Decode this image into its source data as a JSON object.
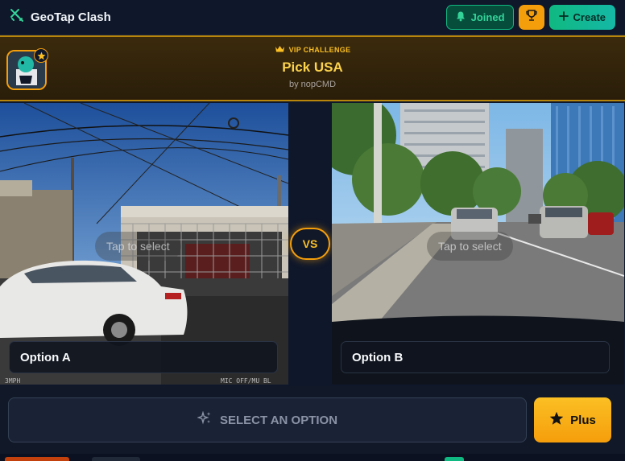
{
  "header": {
    "app_title": "GeoTap Clash",
    "joined_label": "Joined",
    "create_label": "Create",
    "icons": {
      "logo": "crossed-swords-icon",
      "joined": "bell-icon",
      "trophy": "trophy-icon",
      "create": "plus-icon"
    }
  },
  "challenge": {
    "badge": "VIP CHALLENGE",
    "title": "Pick USA",
    "author": "by nopCMD"
  },
  "options": [
    {
      "label": "Option A",
      "hint": "Tap to select"
    },
    {
      "label": "Option B",
      "hint": "Tap to select"
    }
  ],
  "vs_label": "VS",
  "footer": {
    "select_label": "SELECT AN OPTION",
    "plus_label": "Plus"
  },
  "colors": {
    "accent_gold": "#f59e0b",
    "accent_green": "#10b981",
    "background": "#0d1424"
  }
}
